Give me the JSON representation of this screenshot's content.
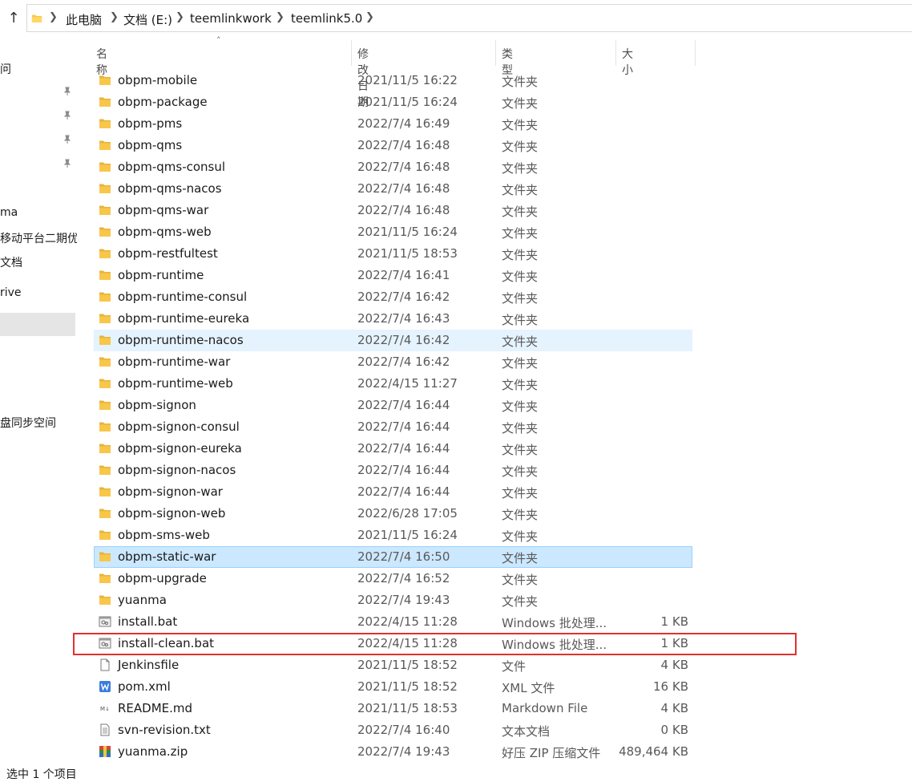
{
  "breadcrumb": {
    "items": [
      "此电脑",
      "文档 (E:)",
      "teemlinkwork",
      "teemlink5.0"
    ]
  },
  "nav": {
    "items": [
      "问",
      "ma",
      "移动平台二期优",
      "文档",
      "rive",
      "盘同步空间"
    ]
  },
  "columns": {
    "name": "名称",
    "date": "修改日期",
    "type": "类型",
    "size": "大小"
  },
  "files": [
    {
      "name": "obpm-mobile",
      "date": "2021/11/5 16:22",
      "type": "文件夹",
      "size": "",
      "icon": "folder-icon"
    },
    {
      "name": "obpm-package",
      "date": "2021/11/5 16:24",
      "type": "文件夹",
      "size": "",
      "icon": "folder-icon"
    },
    {
      "name": "obpm-pms",
      "date": "2022/7/4 16:49",
      "type": "文件夹",
      "size": "",
      "icon": "folder-icon"
    },
    {
      "name": "obpm-qms",
      "date": "2022/7/4 16:48",
      "type": "文件夹",
      "size": "",
      "icon": "folder-icon"
    },
    {
      "name": "obpm-qms-consul",
      "date": "2022/7/4 16:48",
      "type": "文件夹",
      "size": "",
      "icon": "folder-icon"
    },
    {
      "name": "obpm-qms-nacos",
      "date": "2022/7/4 16:48",
      "type": "文件夹",
      "size": "",
      "icon": "folder-icon"
    },
    {
      "name": "obpm-qms-war",
      "date": "2022/7/4 16:48",
      "type": "文件夹",
      "size": "",
      "icon": "folder-icon"
    },
    {
      "name": "obpm-qms-web",
      "date": "2021/11/5 16:24",
      "type": "文件夹",
      "size": "",
      "icon": "folder-icon"
    },
    {
      "name": "obpm-restfultest",
      "date": "2021/11/5 18:53",
      "type": "文件夹",
      "size": "",
      "icon": "folder-icon"
    },
    {
      "name": "obpm-runtime",
      "date": "2022/7/4 16:41",
      "type": "文件夹",
      "size": "",
      "icon": "folder-icon"
    },
    {
      "name": "obpm-runtime-consul",
      "date": "2022/7/4 16:42",
      "type": "文件夹",
      "size": "",
      "icon": "folder-icon"
    },
    {
      "name": "obpm-runtime-eureka",
      "date": "2022/7/4 16:43",
      "type": "文件夹",
      "size": "",
      "icon": "folder-icon"
    },
    {
      "name": "obpm-runtime-nacos",
      "date": "2022/7/4 16:42",
      "type": "文件夹",
      "size": "",
      "icon": "folder-icon",
      "state": "hover"
    },
    {
      "name": "obpm-runtime-war",
      "date": "2022/7/4 16:42",
      "type": "文件夹",
      "size": "",
      "icon": "folder-icon"
    },
    {
      "name": "obpm-runtime-web",
      "date": "2022/4/15 11:27",
      "type": "文件夹",
      "size": "",
      "icon": "folder-icon"
    },
    {
      "name": "obpm-signon",
      "date": "2022/7/4 16:44",
      "type": "文件夹",
      "size": "",
      "icon": "folder-icon"
    },
    {
      "name": "obpm-signon-consul",
      "date": "2022/7/4 16:44",
      "type": "文件夹",
      "size": "",
      "icon": "folder-icon"
    },
    {
      "name": "obpm-signon-eureka",
      "date": "2022/7/4 16:44",
      "type": "文件夹",
      "size": "",
      "icon": "folder-icon"
    },
    {
      "name": "obpm-signon-nacos",
      "date": "2022/7/4 16:44",
      "type": "文件夹",
      "size": "",
      "icon": "folder-icon"
    },
    {
      "name": "obpm-signon-war",
      "date": "2022/7/4 16:44",
      "type": "文件夹",
      "size": "",
      "icon": "folder-icon"
    },
    {
      "name": "obpm-signon-web",
      "date": "2022/6/28 17:05",
      "type": "文件夹",
      "size": "",
      "icon": "folder-icon"
    },
    {
      "name": "obpm-sms-web",
      "date": "2021/11/5 16:24",
      "type": "文件夹",
      "size": "",
      "icon": "folder-icon"
    },
    {
      "name": "obpm-static-war",
      "date": "2022/7/4 16:50",
      "type": "文件夹",
      "size": "",
      "icon": "folder-icon",
      "state": "selected"
    },
    {
      "name": "obpm-upgrade",
      "date": "2022/7/4 16:52",
      "type": "文件夹",
      "size": "",
      "icon": "folder-icon"
    },
    {
      "name": "yuanma",
      "date": "2022/7/4 19:43",
      "type": "文件夹",
      "size": "",
      "icon": "folder-icon"
    },
    {
      "name": "install.bat",
      "date": "2022/4/15 11:28",
      "type": "Windows 批处理...",
      "size": "1 KB",
      "icon": "batch-file-icon"
    },
    {
      "name": "install-clean.bat",
      "date": "2022/4/15 11:28",
      "type": "Windows 批处理...",
      "size": "1 KB",
      "icon": "batch-file-icon"
    },
    {
      "name": "Jenkinsfile",
      "date": "2021/11/5 18:52",
      "type": "文件",
      "size": "4 KB",
      "icon": "blank-file-icon"
    },
    {
      "name": "pom.xml",
      "date": "2021/11/5 18:52",
      "type": "XML 文件",
      "size": "16 KB",
      "icon": "xml-file-icon"
    },
    {
      "name": "README.md",
      "date": "2021/11/5 18:53",
      "type": "Markdown File",
      "size": "4 KB",
      "icon": "markdown-file-icon"
    },
    {
      "name": "svn-revision.txt",
      "date": "2022/7/4 16:40",
      "type": "文本文档",
      "size": "0 KB",
      "icon": "text-file-icon"
    },
    {
      "name": "yuanma.zip",
      "date": "2022/7/4 19:43",
      "type": "好压 ZIP 压缩文件",
      "size": "489,464 KB",
      "icon": "zip-archive-icon"
    }
  ],
  "status": {
    "text": "选中 1 个项目"
  },
  "colors": {
    "hover": "#e5f3ff",
    "selected": "#cce8ff",
    "highlight_box": "#e03131",
    "folder": "#f8c74a"
  }
}
